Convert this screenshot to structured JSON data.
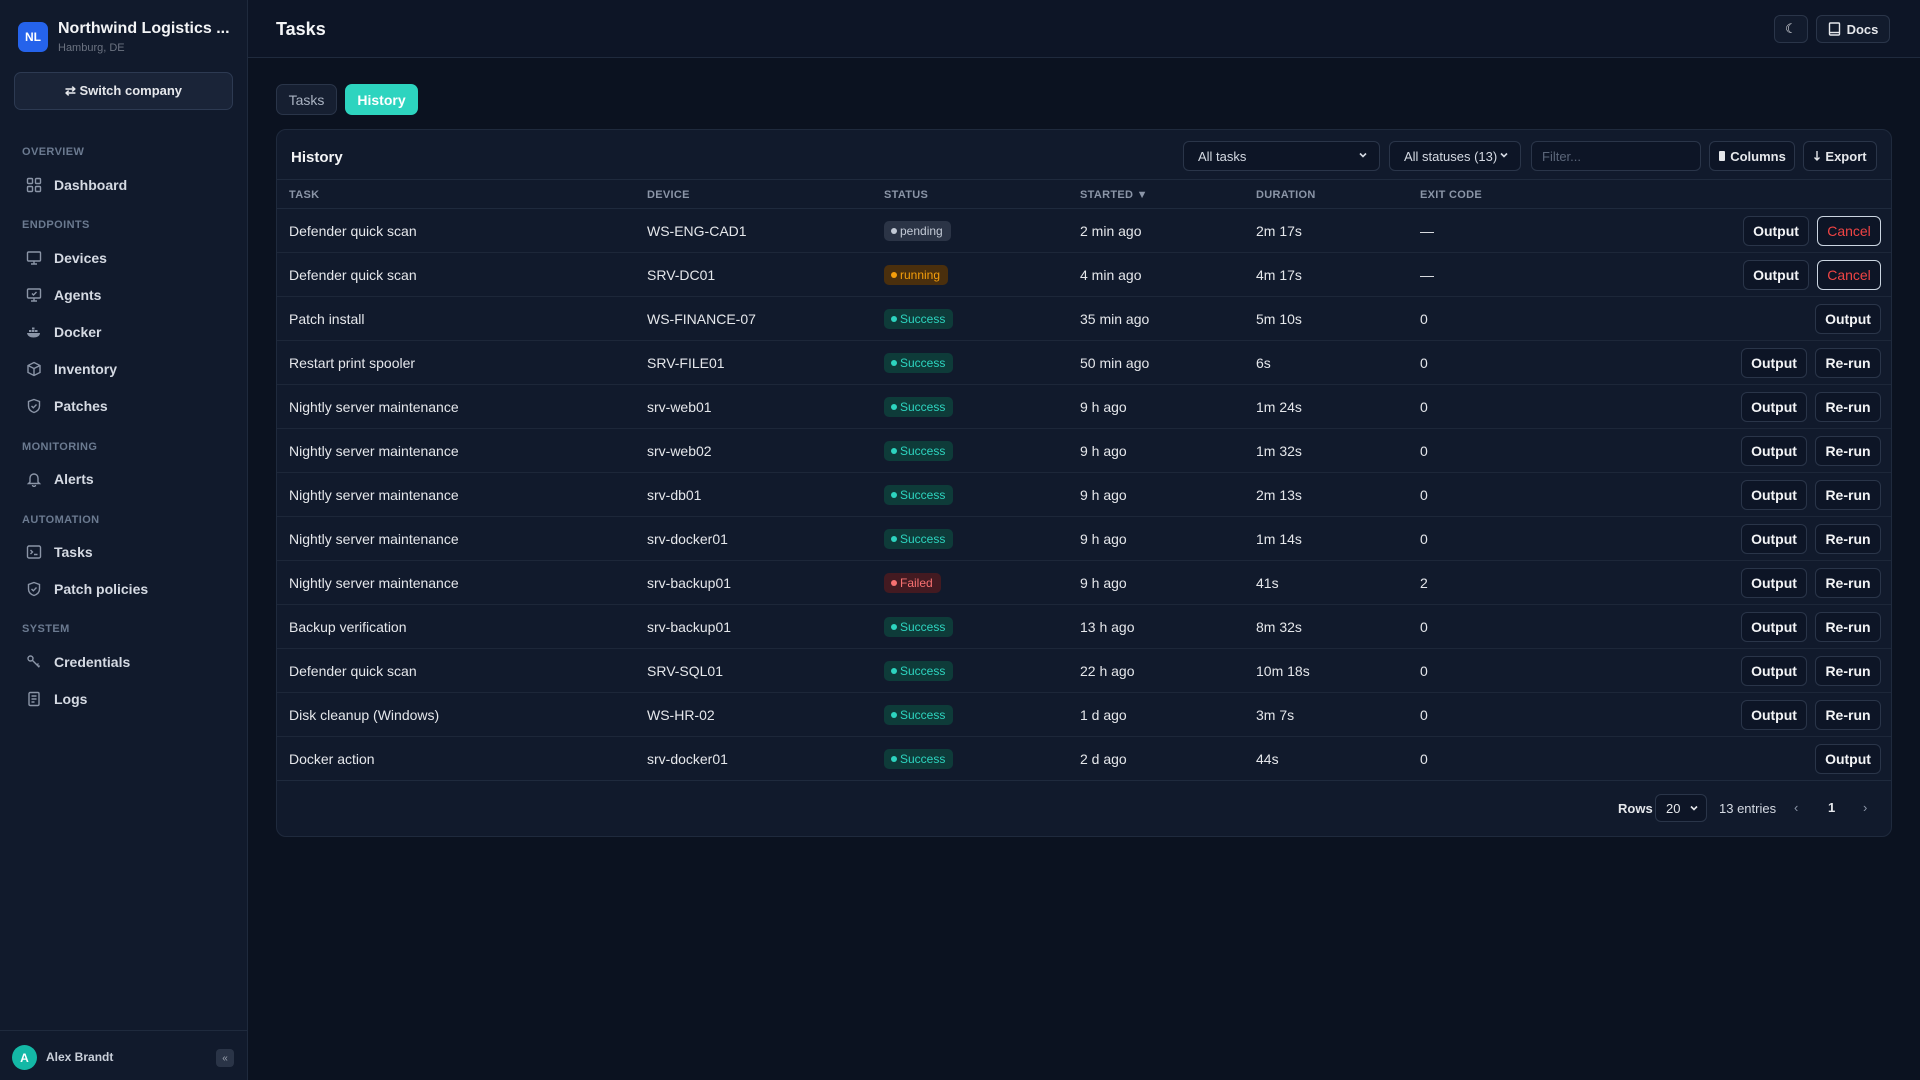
{
  "company": {
    "initials": "NL",
    "name": "Northwind Logistics ...",
    "location": "Hamburg, DE",
    "switch_label": "⇄ Switch company"
  },
  "nav": {
    "overview": "OVERVIEW",
    "dashboard": "Dashboard",
    "endpoints": "ENDPOINTS",
    "devices": "Devices",
    "agents": "Agents",
    "docker": "Docker",
    "inventory": "Inventory",
    "patches": "Patches",
    "monitoring": "MONITORING",
    "alerts": "Alerts",
    "automation": "AUTOMATION",
    "tasks": "Tasks",
    "patch_policies": "Patch policies",
    "system": "SYSTEM",
    "credentials": "Credentials",
    "logs": "Logs"
  },
  "user": {
    "initial": "A",
    "name": "Alex Brandt",
    "collapse": "«"
  },
  "header": {
    "title": "Tasks",
    "theme_icon": "☾",
    "docs_label": "Docs"
  },
  "tabs": {
    "tasks": "Tasks",
    "history": "History"
  },
  "card": {
    "title": "History",
    "task_filter": "All tasks",
    "status_filter": "All statuses (13)",
    "filter_placeholder": "Filter...",
    "columns_label": "Columns",
    "export_label": "Export"
  },
  "columns": {
    "task": "TASK",
    "device": "DEVICE",
    "status": "STATUS",
    "started": "STARTED ▼",
    "duration": "DURATION",
    "exit_code": "EXIT CODE"
  },
  "rows": [
    {
      "task": "Defender quick scan",
      "device": "WS-ENG-CAD1",
      "status": "pending",
      "started": "2 min ago",
      "duration": "2m 17s",
      "exit": "—",
      "actions": [
        "Output",
        "Cancel"
      ]
    },
    {
      "task": "Defender quick scan",
      "device": "SRV-DC01",
      "status": "running",
      "started": "4 min ago",
      "duration": "4m 17s",
      "exit": "—",
      "actions": [
        "Output",
        "Cancel"
      ]
    },
    {
      "task": "Patch install",
      "device": "WS-FINANCE-07",
      "status": "Success",
      "started": "35 min ago",
      "duration": "5m 10s",
      "exit": "0",
      "actions": [
        "Output"
      ]
    },
    {
      "task": "Restart print spooler",
      "device": "SRV-FILE01",
      "status": "Success",
      "started": "50 min ago",
      "duration": "6s",
      "exit": "0",
      "actions": [
        "Output",
        "Re-run"
      ]
    },
    {
      "task": "Nightly server maintenance",
      "device": "srv-web01",
      "status": "Success",
      "started": "9 h ago",
      "duration": "1m 24s",
      "exit": "0",
      "actions": [
        "Output",
        "Re-run"
      ]
    },
    {
      "task": "Nightly server maintenance",
      "device": "srv-web02",
      "status": "Success",
      "started": "9 h ago",
      "duration": "1m 32s",
      "exit": "0",
      "actions": [
        "Output",
        "Re-run"
      ]
    },
    {
      "task": "Nightly server maintenance",
      "device": "srv-db01",
      "status": "Success",
      "started": "9 h ago",
      "duration": "2m 13s",
      "exit": "0",
      "actions": [
        "Output",
        "Re-run"
      ]
    },
    {
      "task": "Nightly server maintenance",
      "device": "srv-docker01",
      "status": "Success",
      "started": "9 h ago",
      "duration": "1m 14s",
      "exit": "0",
      "actions": [
        "Output",
        "Re-run"
      ]
    },
    {
      "task": "Nightly server maintenance",
      "device": "srv-backup01",
      "status": "Failed",
      "started": "9 h ago",
      "duration": "41s",
      "exit": "2",
      "actions": [
        "Output",
        "Re-run"
      ]
    },
    {
      "task": "Backup verification",
      "device": "srv-backup01",
      "status": "Success",
      "started": "13 h ago",
      "duration": "8m 32s",
      "exit": "0",
      "actions": [
        "Output",
        "Re-run"
      ]
    },
    {
      "task": "Defender quick scan",
      "device": "SRV-SQL01",
      "status": "Success",
      "started": "22 h ago",
      "duration": "10m 18s",
      "exit": "0",
      "actions": [
        "Output",
        "Re-run"
      ]
    },
    {
      "task": "Disk cleanup (Windows)",
      "device": "WS-HR-02",
      "status": "Success",
      "started": "1 d ago",
      "duration": "3m 7s",
      "exit": "0",
      "actions": [
        "Output",
        "Re-run"
      ]
    },
    {
      "task": "Docker action",
      "device": "srv-docker01",
      "status": "Success",
      "started": "2 d ago",
      "duration": "44s",
      "exit": "0",
      "actions": [
        "Output"
      ]
    }
  ],
  "footer": {
    "rows_label": "Rows",
    "rows_value": "20",
    "entries": "13 entries",
    "page": "1",
    "prev": "‹",
    "next": "›"
  },
  "colors": {
    "accent": "#2dd4bf",
    "success": "#2dd4bf",
    "pending": "#c3cad6",
    "running": "#f59e0b",
    "failed": "#f87171",
    "cancel": "#ef4444"
  }
}
